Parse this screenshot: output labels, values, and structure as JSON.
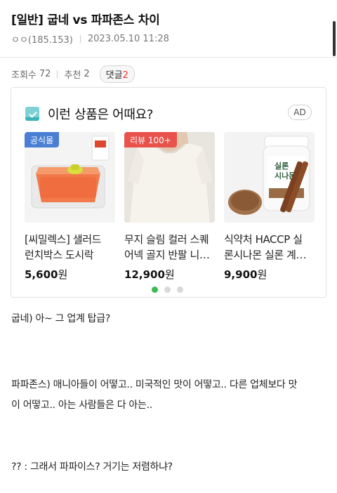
{
  "post": {
    "title": "[일반] 굽네 vs 파파존스 차이",
    "author": "ㅇㅇ(185.153)",
    "timestamp": "2023.05.10 11:28"
  },
  "stats": {
    "views_label": "조회수",
    "views": "72",
    "recommend_label": "추천",
    "recommend": "2",
    "comments_label": "댓글",
    "comments": "2"
  },
  "ad": {
    "title": "이런 상품은 어때요?",
    "badge": "AD",
    "products": [
      {
        "badge": "공식몰",
        "badge_color": "#4a7fd4",
        "name_line1": "[씨밀렉스] 샐러드",
        "name_line2": "런치박스 도시락",
        "price": "5,600",
        "unit": "원"
      },
      {
        "badge": "리뷰 100+",
        "badge_color": "#e8524a",
        "name_line1": "무지 슬림 컬러 스퀘",
        "name_line2": "어넥 골지 반팔 니…",
        "price": "12,900",
        "unit": "원"
      },
      {
        "badge": "",
        "badge_color": "",
        "name_line1": "식약처 HACCP 실",
        "name_line2": "론시나몬 실론 계…",
        "price": "9,900",
        "unit": "원"
      }
    ],
    "product3_label_line1": "실론",
    "product3_label_line2": "시나몬",
    "page_count": 3,
    "active_page": 1
  },
  "content": {
    "lines": [
      "굽네) 아~ 그 업계 탑급?",
      "파파존스) 매니아들이 어떻고.. 미국적인 맛이 어떻고.. 다른 업체보다 맛",
      "이 어떻고.. 아는 사람들은 다 아는..",
      "?? : 그래서 파파이스? 거기는 저렴하냐?"
    ]
  }
}
